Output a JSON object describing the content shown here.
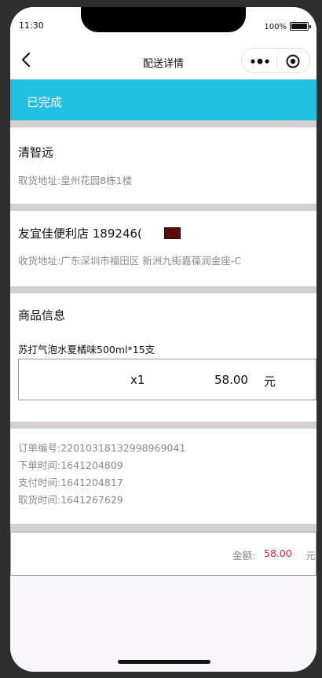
{
  "statusbar": {
    "time": "11:30",
    "battery": "100%"
  },
  "navbar": {
    "title": "配送详情",
    "back_icon": "chevron-left-icon",
    "more_icon": "more-dots-icon",
    "target_icon": "record-target-icon"
  },
  "banner": {
    "status": "已完成",
    "color": "#21bfe0"
  },
  "pickup": {
    "name": "清智远",
    "address_label": "取货地址:",
    "address": "皇州花园8栋1楼"
  },
  "delivery": {
    "name": "友宜佳便利店 189246(",
    "address_label": "收货地址:",
    "address": "广东深圳市福田区 新洲九街嘉葆润金座-C"
  },
  "goods": {
    "section_title": "商品信息",
    "item_name": "苏打气泡水夏橘味500ml*15支",
    "quantity": "x1",
    "price": "58.00",
    "unit": "元"
  },
  "order": {
    "number": "订单编号:22010318132998969041",
    "order_time": "下单时间:1641204809",
    "pay_time": "支付时间:1641204817",
    "pickup_time": "取货时间:1641267629"
  },
  "footer": {
    "amount_label": "金额:",
    "amount": "58.00",
    "unit": "元",
    "amount_color": "#e8252b"
  }
}
